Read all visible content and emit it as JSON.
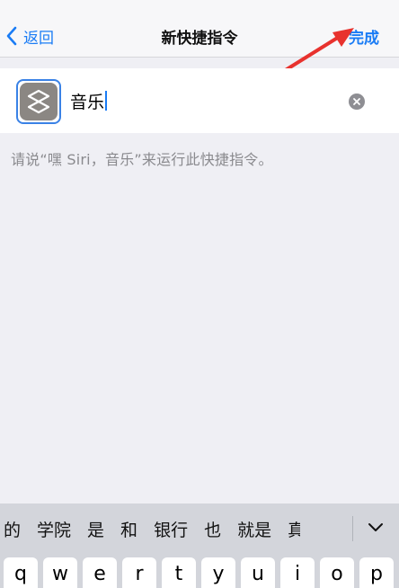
{
  "navbar": {
    "back_label": "返回",
    "title": "新快捷指令",
    "done_label": "完成"
  },
  "shortcut": {
    "name_value": "音乐"
  },
  "hint": {
    "text": "请说“嘿 Siri，音乐”来运行此快捷指令。"
  },
  "candidates": [
    "的",
    "学院",
    "是",
    "和",
    "银行",
    "也",
    "就是",
    "真"
  ],
  "keyboard": {
    "row1": [
      "q",
      "w",
      "e",
      "r",
      "t",
      "y",
      "u",
      "i",
      "o",
      "p"
    ]
  },
  "colors": {
    "accent": "#1a7cf5",
    "annotation_arrow": "#e8322e",
    "icon_bg": "#8b8783"
  },
  "icons": {
    "back": "chevron-left-icon",
    "app": "shortcuts-icon",
    "clear": "clear-icon",
    "expand": "chevron-down-icon"
  }
}
